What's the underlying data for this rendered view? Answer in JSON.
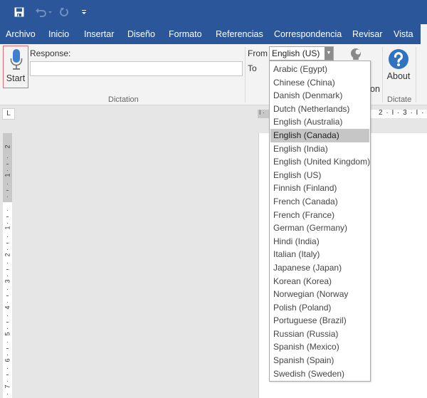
{
  "quick_access": {
    "save_icon": "save-icon",
    "undo_icon": "undo-icon",
    "redo_icon": "redo-icon",
    "customize_icon": "customize-qat-icon"
  },
  "ribbon_tabs": [
    {
      "label": "Archivo"
    },
    {
      "label": "Inicio"
    },
    {
      "label": "Insertar"
    },
    {
      "label": "Diseño"
    },
    {
      "label": "Formato"
    },
    {
      "label": "Referencias"
    },
    {
      "label": "Correspondencia"
    },
    {
      "label": "Revisar"
    },
    {
      "label": "Vista"
    }
  ],
  "dictation_group": {
    "start_label": "Start",
    "response_label": "Response:",
    "response_value": "",
    "group_label": "Dictation"
  },
  "translation_group": {
    "from_label": "From",
    "to_label": "To",
    "from_value": "English (US)",
    "translation_label_tail": "on"
  },
  "dictate_group": {
    "about_label": "About",
    "group_label": "Dictate"
  },
  "rulers": {
    "tab_selector": "L",
    "horizontal_left": "I ·",
    "horizontal_ticks": "2 · I · 3 · I ·",
    "vertical_numbers": [
      "2",
      "1",
      "1",
      "2",
      "3",
      "4",
      "5",
      "6",
      "7"
    ]
  },
  "language_dropdown": {
    "selected": "English (Canada)",
    "options": [
      "Arabic (Egypt)",
      "Chinese (China)",
      "Danish (Denmark)",
      "Dutch (Netherlands)",
      "English (Australia)",
      "English (Canada)",
      "English (India)",
      "English (United Kingdom)",
      "English (US)",
      "Finnish (Finland)",
      "French (Canada)",
      "French (France)",
      "German (Germany)",
      "Hindi (India)",
      "Italian (Italy)",
      "Japanese (Japan)",
      "Korean (Korea)",
      "Norwegian (Norway",
      "Polish (Poland)",
      "Portuguese (Brazil)",
      "Russian (Russia)",
      "Spanish (Mexico)",
      "Spanish (Spain)",
      "Swedish (Sweden)"
    ]
  },
  "colors": {
    "title_bar": "#2b579a",
    "ribbon_bg": "#f3f3f3",
    "start_border": "#e06b72",
    "mic_blue": "#3f7fcf",
    "about_blue": "#2f72bf",
    "selected_item": "#c6c6c6"
  }
}
